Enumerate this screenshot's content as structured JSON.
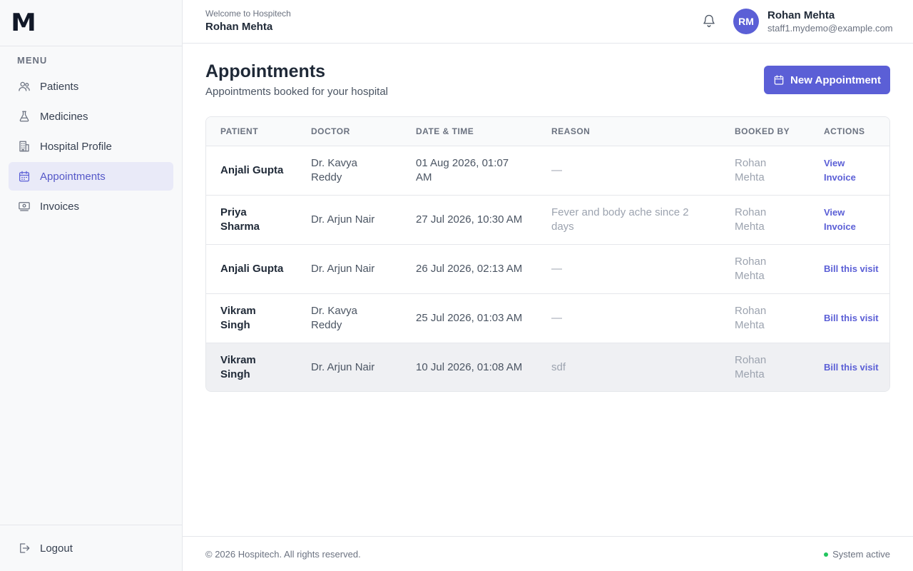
{
  "brand": {
    "logo": "M"
  },
  "sidebar": {
    "menu_heading": "MENU",
    "items": [
      {
        "label": "Patients",
        "icon": "users-icon"
      },
      {
        "label": "Medicines",
        "icon": "flask-icon"
      },
      {
        "label": "Hospital Profile",
        "icon": "building-icon"
      },
      {
        "label": "Appointments",
        "icon": "calendar-icon",
        "active": true
      },
      {
        "label": "Invoices",
        "icon": "banknote-icon"
      }
    ],
    "logout": "Logout"
  },
  "header": {
    "welcome": "Welcome to Hospitech",
    "welcome_name": "Rohan Mehta",
    "avatar_initials": "RM",
    "user_name": "Rohan Mehta",
    "user_email": "staff1.mydemo@example.com"
  },
  "main": {
    "title": "Appointments",
    "subtitle": "Appointments booked for your hospital",
    "new_button": "New Appointment",
    "columns": [
      "Patient",
      "Doctor",
      "Date & Time",
      "Reason",
      "Booked By",
      "Actions"
    ],
    "rows": [
      {
        "patient": "Anjali Gupta",
        "doctor": "Dr. Kavya Reddy",
        "datetime": "01 Aug 2026, 01:07 AM",
        "reason": "—",
        "booked_by": "Rohan Mehta",
        "actions": [
          "View",
          "Invoice"
        ]
      },
      {
        "patient": "Priya Sharma",
        "doctor": "Dr. Arjun Nair",
        "datetime": "27 Jul 2026, 10:30 AM",
        "reason": "Fever and body ache since 2 days",
        "booked_by": "Rohan Mehta",
        "actions": [
          "View",
          "Invoice"
        ]
      },
      {
        "patient": "Anjali Gupta",
        "doctor": "Dr. Arjun Nair",
        "datetime": "26 Jul 2026, 02:13 AM",
        "reason": "—",
        "booked_by": "Rohan Mehta",
        "actions": [
          "Bill this visit"
        ]
      },
      {
        "patient": "Vikram Singh",
        "doctor": "Dr. Kavya Reddy",
        "datetime": "25 Jul 2026, 01:03 AM",
        "reason": "—",
        "booked_by": "Rohan Mehta",
        "actions": [
          "Bill this visit"
        ]
      },
      {
        "patient": "Vikram Singh",
        "doctor": "Dr. Arjun Nair",
        "datetime": "10 Jul 2026, 01:08 AM",
        "reason": "sdf",
        "booked_by": "Rohan Mehta",
        "actions": [
          "Bill this visit"
        ]
      }
    ]
  },
  "footer": {
    "copyright": "© 2026 Hospitech. All rights reserved.",
    "status": "System active",
    "status_color": "#22c55e"
  },
  "colors": {
    "accent": "#5b5fd6",
    "active_bg": "#e9eaf8"
  }
}
